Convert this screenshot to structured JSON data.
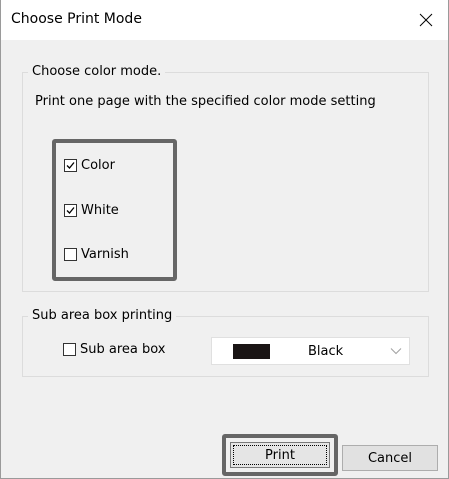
{
  "window": {
    "title": "Choose Print Mode",
    "close_glyph": "✕"
  },
  "color_mode": {
    "legend": "Choose color mode.",
    "description": "Print one page with the specified color mode setting",
    "options": [
      {
        "label": "Color",
        "checked": true
      },
      {
        "label": "White",
        "checked": true
      },
      {
        "label": "Varnish",
        "checked": false
      }
    ]
  },
  "sub_area": {
    "legend": "Sub area box printing",
    "checkbox_label": "Sub area box",
    "checked": false,
    "color_select": {
      "selected": "Black",
      "swatch_color": "#1a1515"
    }
  },
  "buttons": {
    "print": "Print",
    "cancel": "Cancel"
  }
}
